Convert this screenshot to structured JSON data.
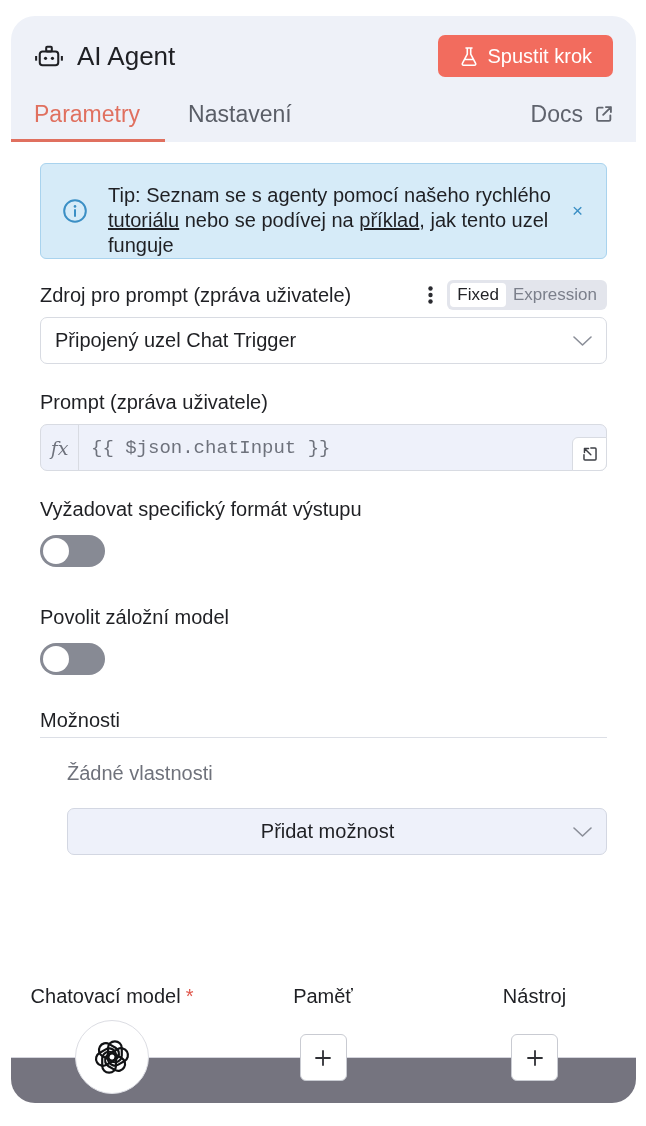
{
  "header": {
    "title": "AI Agent",
    "run_button": "Spustit krok"
  },
  "tabs": [
    {
      "label": "Parametry",
      "selected": true
    },
    {
      "label": "Nastavení",
      "selected": false
    }
  ],
  "docs_link": "Docs",
  "tip": {
    "parts": [
      {
        "kind": "text",
        "text": "Tip: Seznam se s agenty pomocí našeho rychlého "
      },
      {
        "kind": "link",
        "text": "tutoriálu"
      },
      {
        "kind": "text",
        "text": " nebo se podívej na "
      },
      {
        "kind": "link",
        "text": "příklad"
      },
      {
        "kind": "text",
        "text": ", jak tento uzel funguje"
      }
    ],
    "close": "×"
  },
  "fields": [
    {
      "kind": "select",
      "label": "Zdroj pro prompt (zpráva uživatele)",
      "modes": [
        {
          "label": "Fixed",
          "selected": true
        },
        {
          "label": "Expression",
          "selected": false
        }
      ],
      "value": "Připojený uzel Chat Trigger"
    },
    {
      "kind": "expression",
      "label": "Prompt (zpráva uživatele)",
      "prefix": "fx",
      "value": "{{ $json.chatInput }}"
    },
    {
      "kind": "toggle",
      "label": "Vyžadovat specifický formát výstupu",
      "on": false
    },
    {
      "kind": "toggle",
      "label": "Povolit záložní model",
      "on": false
    },
    {
      "kind": "collection",
      "label": "Možnosti",
      "empty_text": "Žádné vlastnosti",
      "add_label": "Přidat možnost"
    }
  ],
  "connectors": [
    {
      "kind": "model",
      "label": "Chatovací model",
      "required_mark": "*"
    },
    {
      "kind": "add",
      "label": "Paměť"
    },
    {
      "kind": "add",
      "label": "Nástroj"
    }
  ]
}
